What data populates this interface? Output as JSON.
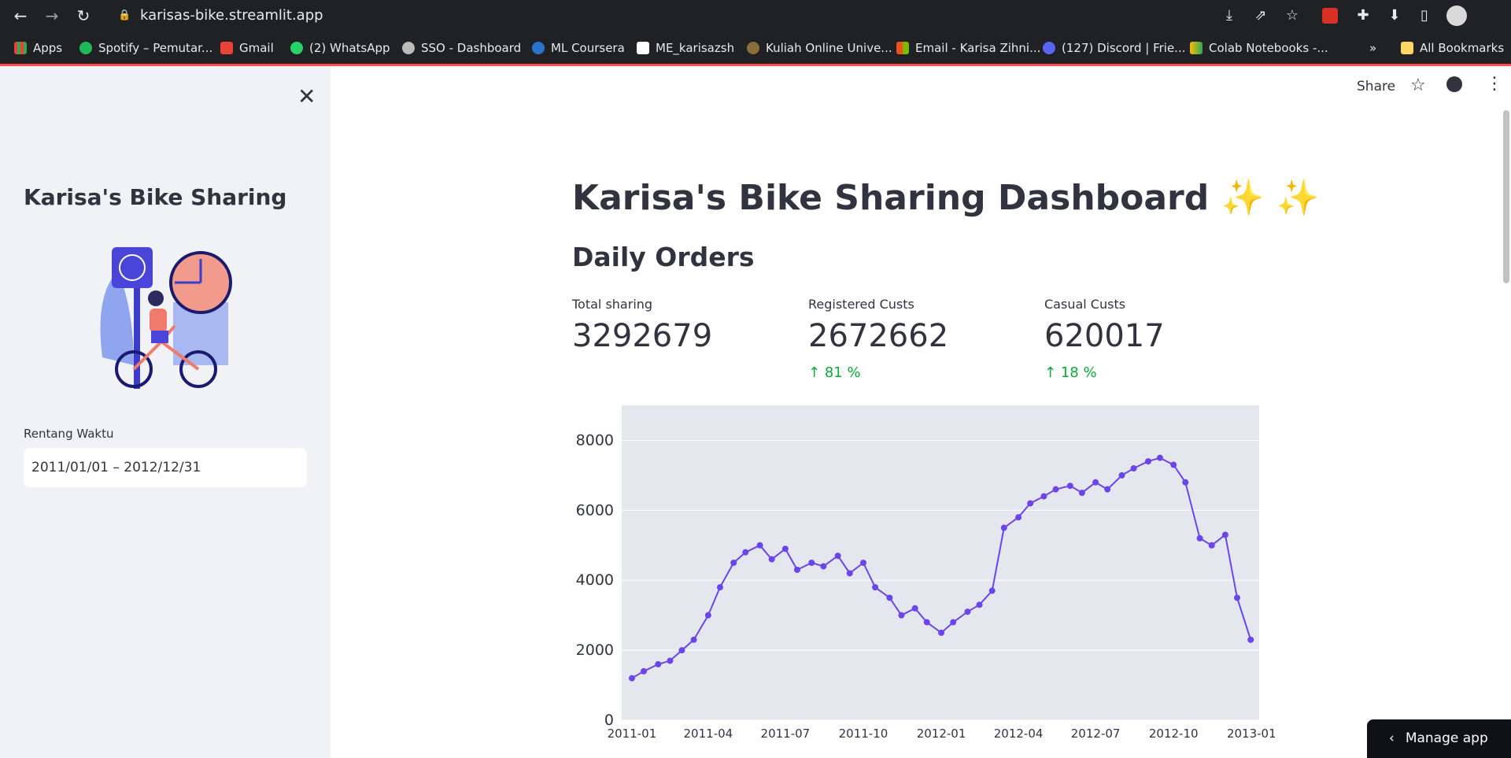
{
  "browser": {
    "url": "karisas-bike.streamlit.app",
    "bookmarks": [
      "Apps",
      "Spotify – Pemutar...",
      "Gmail",
      "(2) WhatsApp",
      "SSO - Dashboard",
      "ML Coursera",
      "ME_karisazsh",
      "Kuliah Online Unive...",
      "Email - Karisa Zihni...",
      "(127) Discord | Frie...",
      "Colab Notebooks -...",
      "»",
      "All Bookmarks"
    ]
  },
  "topbar": {
    "share": "Share"
  },
  "sidebar": {
    "title": "Karisa's Bike Sharing",
    "date_label": "Rentang Waktu",
    "date_value": "2011/01/01 – 2012/12/31"
  },
  "main": {
    "title": "Karisa's Bike Sharing Dashboard ✨ ✨",
    "subtitle": "Daily Orders",
    "metrics": [
      {
        "label": "Total sharing",
        "value": "3292679",
        "delta": ""
      },
      {
        "label": "Registered Custs",
        "value": "2672662",
        "delta": "81 %"
      },
      {
        "label": "Casual Custs",
        "value": "620017",
        "delta": "18 %"
      }
    ]
  },
  "manage_app": "Manage app",
  "chart_data": {
    "type": "line",
    "x_tick_labels": [
      "2011-01",
      "2011-04",
      "2011-07",
      "2011-10",
      "2012-01",
      "2012-04",
      "2012-07",
      "2012-10",
      "2013-01"
    ],
    "y_tick_labels": [
      "0",
      "2000",
      "4000",
      "6000",
      "8000"
    ],
    "ylim": [
      0,
      9000
    ],
    "xlim": [
      "2010-12-20",
      "2013-01-10"
    ],
    "series": [
      {
        "color": "#6b45ea",
        "markers": true,
        "x": [
          "2011-01-01",
          "2011-01-15",
          "2011-02-01",
          "2011-02-15",
          "2011-03-01",
          "2011-03-15",
          "2011-04-01",
          "2011-04-15",
          "2011-05-01",
          "2011-05-15",
          "2011-06-01",
          "2011-06-15",
          "2011-07-01",
          "2011-07-15",
          "2011-08-01",
          "2011-08-15",
          "2011-09-01",
          "2011-09-15",
          "2011-10-01",
          "2011-10-15",
          "2011-11-01",
          "2011-11-15",
          "2011-12-01",
          "2011-12-15",
          "2012-01-01",
          "2012-01-15",
          "2012-02-01",
          "2012-02-15",
          "2012-03-01",
          "2012-03-15",
          "2012-04-01",
          "2012-04-15",
          "2012-05-01",
          "2012-05-15",
          "2012-06-01",
          "2012-06-15",
          "2012-07-01",
          "2012-07-15",
          "2012-08-01",
          "2012-08-15",
          "2012-09-01",
          "2012-09-15",
          "2012-10-01",
          "2012-10-15",
          "2012-11-01",
          "2012-11-15",
          "2012-12-01",
          "2012-12-15",
          "2012-12-31"
        ],
        "y": [
          1200,
          1400,
          1600,
          1700,
          2000,
          2300,
          3000,
          3800,
          4500,
          4800,
          5000,
          4600,
          4900,
          4300,
          4500,
          4400,
          4700,
          4200,
          4500,
          3800,
          3500,
          3000,
          3200,
          2800,
          2500,
          2800,
          3100,
          3300,
          3700,
          5500,
          5800,
          6200,
          6400,
          6600,
          6700,
          6500,
          6800,
          6600,
          7000,
          7200,
          7400,
          7500,
          7300,
          6800,
          5200,
          5000,
          5300,
          3500,
          2300
        ]
      }
    ]
  }
}
